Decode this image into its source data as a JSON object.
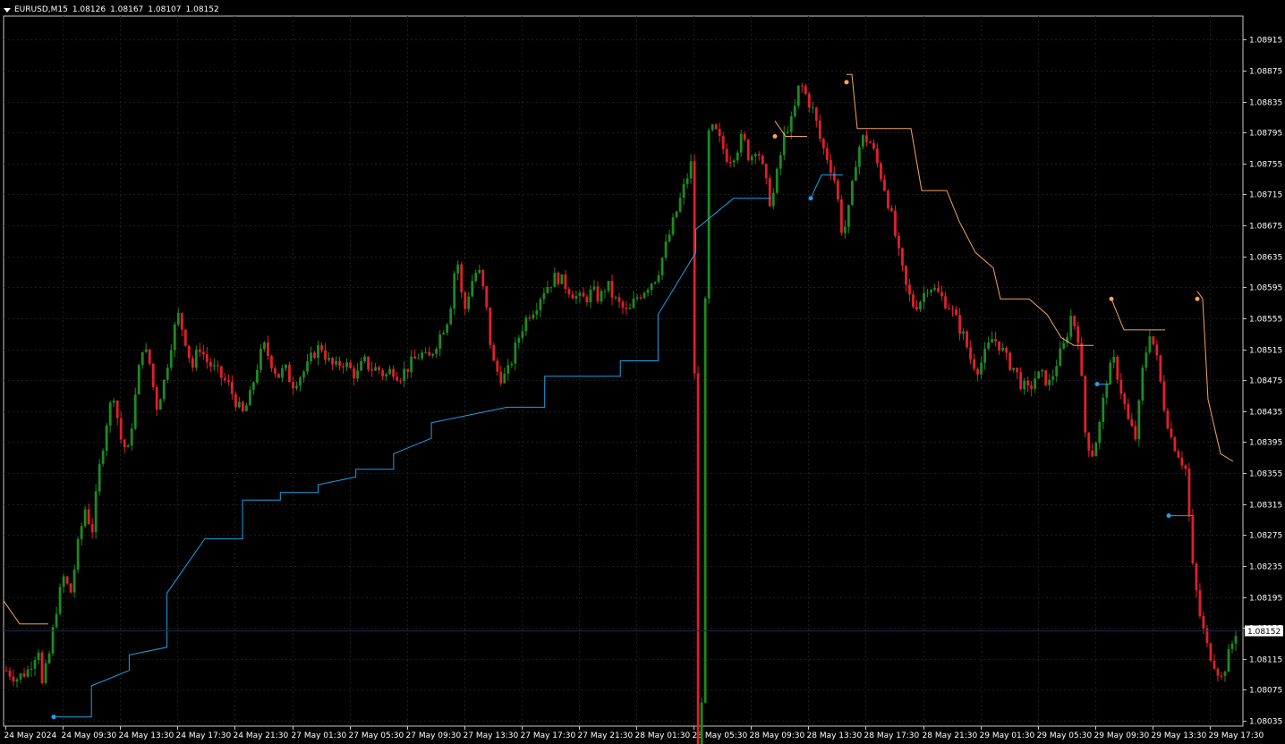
{
  "header": {
    "symbol": "EURUSD,M15",
    "open": "1.08126",
    "high": "1.08167",
    "low": "1.08107",
    "close": "1.08152",
    "menu_icon": "triangle-down-icon"
  },
  "colors": {
    "background": "#000000",
    "grid": "#1e1e1e",
    "axis": "#c8c8c8",
    "text": "#ffffff",
    "bull": "#1f8a1f",
    "bear": "#e0202a",
    "support_line": "#1ea0e6",
    "resistance_line": "#f5a45a",
    "current_price_line": "#1a2c4a"
  },
  "chart_data": {
    "type": "candlestick",
    "symbol": "EURUSD",
    "timeframe": "M15",
    "current_price": 1.08152,
    "current_price_label": "1.08152",
    "ylim": [
      1.08035,
      1.08935
    ],
    "y_ticks": [
      "1.08915",
      "1.08875",
      "1.08835",
      "1.08795",
      "1.08755",
      "1.08715",
      "1.08675",
      "1.08635",
      "1.08595",
      "1.08555",
      "1.08515",
      "1.08475",
      "1.08435",
      "1.08395",
      "1.08355",
      "1.08315",
      "1.08275",
      "1.08235",
      "1.08195",
      "1.08155",
      "1.08115",
      "1.08075",
      "1.08035"
    ],
    "x_ticks": [
      "24 May 2024",
      "24 May 09:30",
      "24 May 13:30",
      "24 May 17:30",
      "24 May 21:30",
      "27 May 01:30",
      "27 May 05:30",
      "27 May 09:30",
      "27 May 13:30",
      "27 May 17:30",
      "27 May 21:30",
      "28 May 01:30",
      "28 May 05:30",
      "28 May 09:30",
      "28 May 13:30",
      "28 May 17:30",
      "28 May 21:30",
      "29 May 01:30",
      "29 May 05:30",
      "29 May 09:30",
      "29 May 13:30",
      "29 May 17:30"
    ],
    "close_path": [
      [
        0,
        1.081
      ],
      [
        3,
        1.0809
      ],
      [
        6,
        1.081
      ],
      [
        9,
        1.0813
      ],
      [
        10,
        1.0808
      ],
      [
        12,
        1.0812
      ],
      [
        14,
        1.0818
      ],
      [
        16,
        1.0822
      ],
      [
        18,
        1.082
      ],
      [
        20,
        1.0826
      ],
      [
        22,
        1.0831
      ],
      [
        24,
        1.0828
      ],
      [
        26,
        1.0836
      ],
      [
        28,
        1.0842
      ],
      [
        30,
        1.0846
      ],
      [
        32,
        1.084
      ],
      [
        34,
        1.0838
      ],
      [
        36,
        1.0845
      ],
      [
        38,
        1.0852
      ],
      [
        40,
        1.085
      ],
      [
        42,
        1.0844
      ],
      [
        44,
        1.0847
      ],
      [
        46,
        1.0852
      ],
      [
        48,
        1.0856
      ],
      [
        50,
        1.0853
      ],
      [
        52,
        1.0849
      ],
      [
        54,
        1.0852
      ],
      [
        56,
        1.085
      ],
      [
        58,
        1.0849
      ],
      [
        60,
        1.0848
      ],
      [
        62,
        1.0847
      ],
      [
        64,
        1.0845
      ],
      [
        66,
        1.0843
      ],
      [
        68,
        1.0845
      ],
      [
        70,
        1.0849
      ],
      [
        72,
        1.0852
      ],
      [
        74,
        1.085
      ],
      [
        76,
        1.0848
      ],
      [
        78,
        1.0849
      ],
      [
        80,
        1.0847
      ],
      [
        82,
        1.0848
      ],
      [
        84,
        1.0849
      ],
      [
        86,
        1.0851
      ],
      [
        88,
        1.0852
      ],
      [
        90,
        1.085
      ],
      [
        92,
        1.0849
      ],
      [
        94,
        1.085
      ],
      [
        96,
        1.0849
      ],
      [
        98,
        1.0848
      ],
      [
        100,
        1.085
      ],
      [
        102,
        1.0849
      ],
      [
        104,
        1.0849
      ],
      [
        106,
        1.0848
      ],
      [
        108,
        1.0849
      ],
      [
        110,
        1.0848
      ],
      [
        112,
        1.0849
      ],
      [
        114,
        1.085
      ],
      [
        116,
        1.0851
      ],
      [
        118,
        1.085
      ],
      [
        120,
        1.0852
      ],
      [
        122,
        1.0854
      ],
      [
        124,
        1.0856
      ],
      [
        126,
        1.0864
      ],
      [
        128,
        1.0856
      ],
      [
        130,
        1.086
      ],
      [
        132,
        1.0862
      ],
      [
        134,
        1.0858
      ],
      [
        136,
        1.085
      ],
      [
        138,
        1.0848
      ],
      [
        140,
        1.0848
      ],
      [
        142,
        1.0851
      ],
      [
        144,
        1.0854
      ],
      [
        146,
        1.0856
      ],
      [
        148,
        1.0857
      ],
      [
        150,
        1.0859
      ],
      [
        152,
        1.086
      ],
      [
        154,
        1.0861
      ],
      [
        156,
        1.086
      ],
      [
        158,
        1.0859
      ],
      [
        160,
        1.0858
      ],
      [
        162,
        1.0858
      ],
      [
        164,
        1.0859
      ],
      [
        166,
        1.0858
      ],
      [
        168,
        1.086
      ],
      [
        170,
        1.0858
      ],
      [
        172,
        1.0857
      ],
      [
        174,
        1.0856
      ],
      [
        176,
        1.0858
      ],
      [
        178,
        1.0859
      ],
      [
        180,
        1.086
      ],
      [
        182,
        1.0861
      ],
      [
        184,
        1.0864
      ],
      [
        186,
        1.0867
      ],
      [
        188,
        1.087
      ],
      [
        190,
        1.0873
      ],
      [
        192,
        1.0876
      ],
      [
        194,
        1.0778
      ],
      [
        194,
        1.0878
      ],
      [
        196,
        1.0879
      ],
      [
        198,
        1.088
      ],
      [
        200,
        1.0878
      ],
      [
        202,
        1.0876
      ],
      [
        204,
        1.0877
      ],
      [
        206,
        1.0879
      ],
      [
        208,
        1.0876
      ],
      [
        210,
        1.0878
      ],
      [
        212,
        1.0874
      ],
      [
        214,
        1.087
      ],
      [
        216,
        1.0875
      ],
      [
        218,
        1.088
      ],
      [
        220,
        1.0881
      ],
      [
        222,
        1.0886
      ],
      [
        224,
        1.0884
      ],
      [
        226,
        1.0882
      ],
      [
        228,
        1.0878
      ],
      [
        230,
        1.0876
      ],
      [
        232,
        1.0873
      ],
      [
        234,
        1.0866
      ],
      [
        236,
        1.087
      ],
      [
        238,
        1.0877
      ],
      [
        240,
        1.0879
      ],
      [
        242,
        1.0878
      ],
      [
        244,
        1.0875
      ],
      [
        246,
        1.0872
      ],
      [
        248,
        1.0868
      ],
      [
        250,
        1.0863
      ],
      [
        252,
        1.0859
      ],
      [
        254,
        1.0857
      ],
      [
        256,
        1.0858
      ],
      [
        258,
        1.086
      ],
      [
        260,
        1.0859
      ],
      [
        262,
        1.0858
      ],
      [
        264,
        1.0857
      ],
      [
        266,
        1.0855
      ],
      [
        268,
        1.0853
      ],
      [
        270,
        1.085
      ],
      [
        272,
        1.0849
      ],
      [
        274,
        1.0851
      ],
      [
        276,
        1.0853
      ],
      [
        278,
        1.0852
      ],
      [
        280,
        1.085
      ],
      [
        282,
        1.0849
      ],
      [
        284,
        1.0847
      ],
      [
        286,
        1.0846
      ],
      [
        288,
        1.0848
      ],
      [
        290,
        1.0848
      ],
      [
        292,
        1.0847
      ],
      [
        294,
        1.085
      ],
      [
        296,
        1.0852
      ],
      [
        298,
        1.0856
      ],
      [
        300,
        1.0853
      ],
      [
        302,
        1.084
      ],
      [
        304,
        1.0838
      ],
      [
        306,
        1.0842
      ],
      [
        308,
        1.0848
      ],
      [
        310,
        1.085
      ],
      [
        312,
        1.0846
      ],
      [
        314,
        1.0842
      ],
      [
        316,
        1.084
      ],
      [
        318,
        1.0849
      ],
      [
        320,
        1.0854
      ],
      [
        322,
        1.085
      ],
      [
        324,
        1.0844
      ],
      [
        326,
        1.084
      ],
      [
        328,
        1.0838
      ],
      [
        330,
        1.0836
      ],
      [
        332,
        1.0823
      ],
      [
        334,
        1.0817
      ],
      [
        336,
        1.0813
      ],
      [
        338,
        1.0811
      ],
      [
        340,
        1.0809
      ],
      [
        342,
        1.0812
      ],
      [
        344,
        1.0815
      ]
    ],
    "support_steps": [
      [
        1.0804,
        1.0804
      ],
      [
        1.0808,
        1.081
      ],
      [
        1.0812,
        1.0813
      ],
      [
        1.082,
        1.0827
      ],
      [
        1.0827,
        1.0827
      ],
      [
        1.0832,
        1.0832
      ],
      [
        1.0833,
        1.0833
      ],
      [
        1.0834,
        1.0835
      ],
      [
        1.0836,
        1.0836
      ],
      [
        1.0838,
        1.084
      ],
      [
        1.0842,
        1.0843
      ],
      [
        1.0843,
        1.0844
      ],
      [
        1.0844,
        1.0844
      ],
      [
        1.0848,
        1.0848
      ],
      [
        1.0848,
        1.0848
      ],
      [
        1.085,
        1.085
      ],
      [
        1.0856,
        1.0864
      ],
      [
        1.0867,
        1.0871
      ],
      [
        1.0871,
        1.0871
      ]
    ],
    "markers": [
      {
        "kind": "support",
        "price": 1.0804
      },
      {
        "kind": "resistance",
        "price": 1.0879
      },
      {
        "kind": "support",
        "price": 1.0871
      },
      {
        "kind": "resistance",
        "price": 1.0886
      },
      {
        "kind": "resistance",
        "price": 1.0858
      },
      {
        "kind": "support",
        "price": 1.0847
      },
      {
        "kind": "resistance",
        "price": 1.0858
      },
      {
        "kind": "support",
        "price": 1.083
      }
    ]
  }
}
